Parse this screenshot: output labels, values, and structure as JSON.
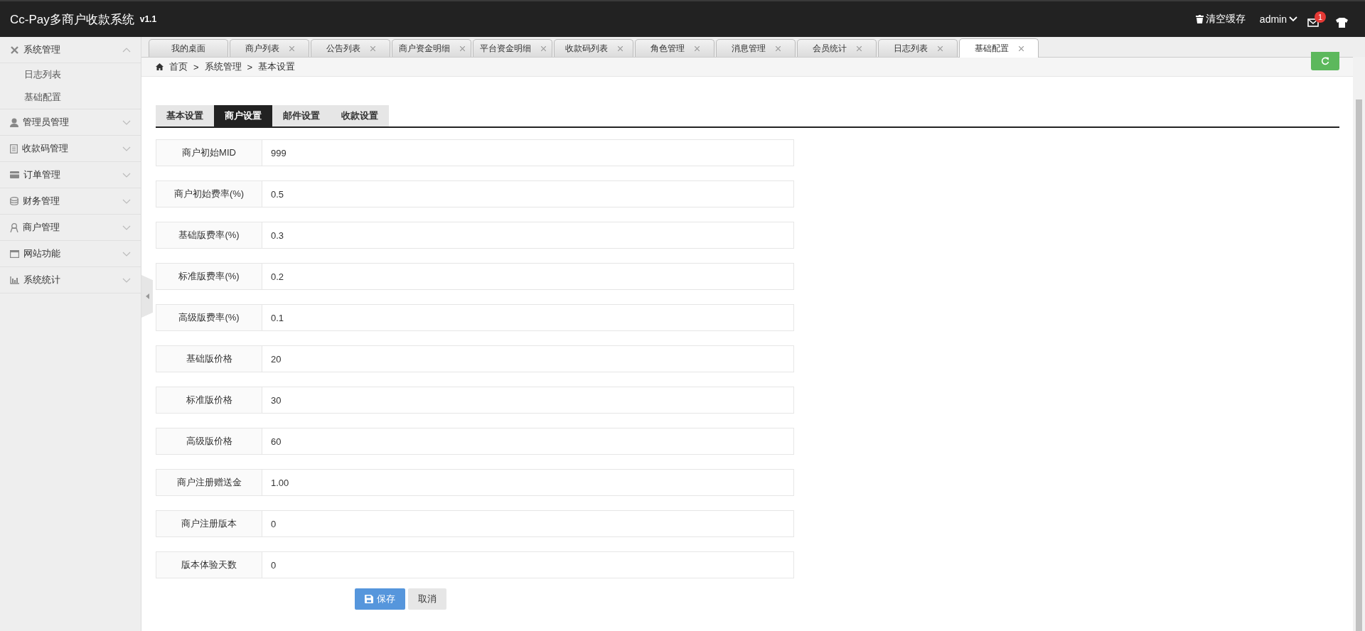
{
  "header": {
    "title": "Cc-Pay多商户收款系统",
    "version": "v1.1",
    "clear_cache": "清空缓存",
    "user": "admin",
    "unread": "1"
  },
  "sidebar": {
    "items": [
      {
        "label": "系统管理",
        "expanded": true,
        "children": [
          {
            "label": "日志列表"
          },
          {
            "label": "基础配置"
          }
        ]
      },
      {
        "label": "管理员管理",
        "expanded": false
      },
      {
        "label": "收款码管理",
        "expanded": false
      },
      {
        "label": "订单管理",
        "expanded": false
      },
      {
        "label": "财务管理",
        "expanded": false
      },
      {
        "label": "商户管理",
        "expanded": false
      },
      {
        "label": "网站功能",
        "expanded": false
      },
      {
        "label": "系统统计",
        "expanded": false
      }
    ]
  },
  "tabs": [
    {
      "label": "我的桌面",
      "selected": false,
      "closable": false
    },
    {
      "label": "商户列表",
      "selected": false,
      "closable": true
    },
    {
      "label": "公告列表",
      "selected": false,
      "closable": true
    },
    {
      "label": "商户资金明细",
      "selected": false,
      "closable": true
    },
    {
      "label": "平台资金明细",
      "selected": false,
      "closable": true
    },
    {
      "label": "收款码列表",
      "selected": false,
      "closable": true
    },
    {
      "label": "角色管理",
      "selected": false,
      "closable": true
    },
    {
      "label": "消息管理",
      "selected": false,
      "closable": true
    },
    {
      "label": "会员统计",
      "selected": false,
      "closable": true
    },
    {
      "label": "日志列表",
      "selected": false,
      "closable": true
    },
    {
      "label": "基础配置",
      "selected": true,
      "closable": true
    }
  ],
  "breadcrumb": [
    "首页",
    "系统管理",
    "基本设置"
  ],
  "breadcrumb_separator": ">",
  "settings_tabs": [
    {
      "label": "基本设置",
      "selected": false
    },
    {
      "label": "商户设置",
      "selected": true
    },
    {
      "label": "邮件设置",
      "selected": false
    },
    {
      "label": "收款设置",
      "selected": false
    }
  ],
  "fields": [
    {
      "label": "商户初始MID",
      "value": "999"
    },
    {
      "label": "商户初始费率(%)",
      "value": "0.5"
    },
    {
      "label": "基础版费率(%)",
      "value": "0.3"
    },
    {
      "label": "标准版费率(%)",
      "value": "0.2"
    },
    {
      "label": "高级版费率(%)",
      "value": "0.1"
    },
    {
      "label": "基础版价格",
      "value": "20"
    },
    {
      "label": "标准版价格",
      "value": "30"
    },
    {
      "label": "高级版价格",
      "value": "60"
    },
    {
      "label": "商户注册赠送金",
      "value": "1.00"
    },
    {
      "label": "商户注册版本",
      "value": "0"
    },
    {
      "label": "版本体验天数",
      "value": "0"
    }
  ],
  "buttons": {
    "save": "保存",
    "cancel": "取消"
  }
}
